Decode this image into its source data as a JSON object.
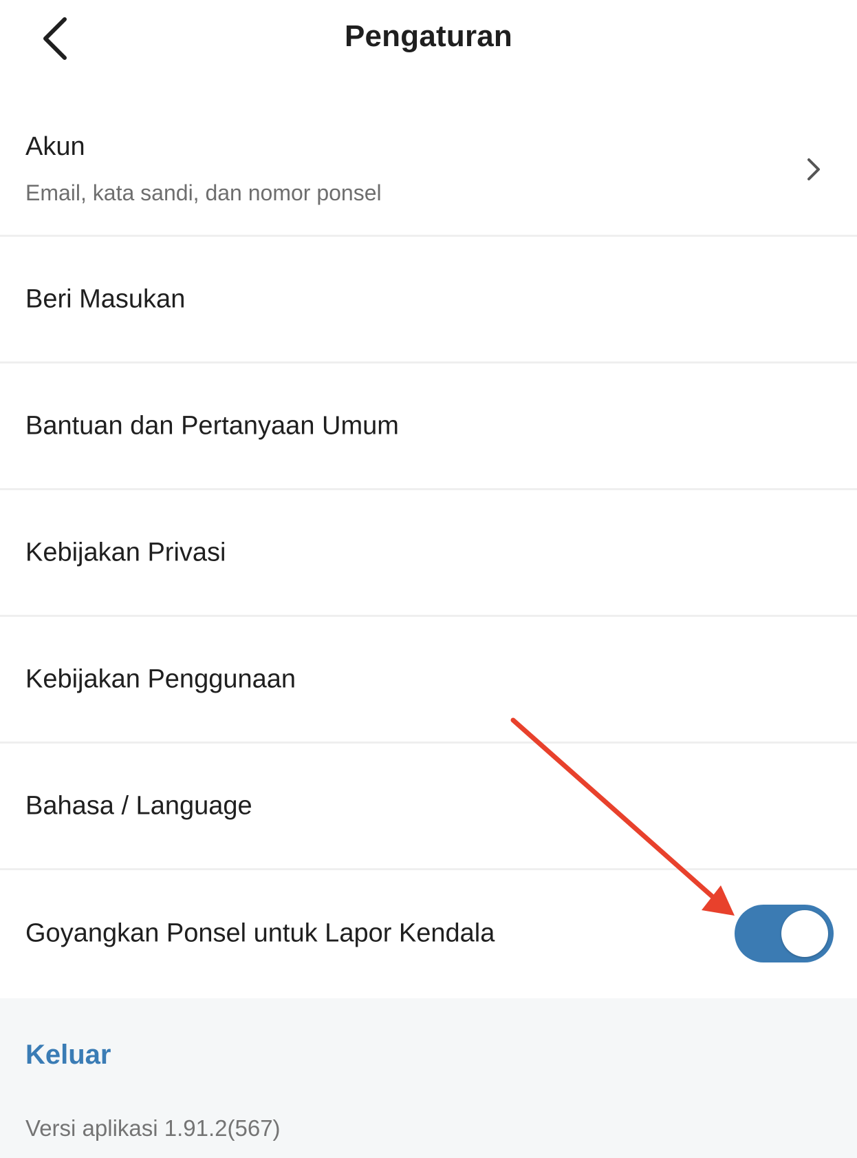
{
  "header": {
    "title": "Pengaturan",
    "back_icon": "chevron-left-icon"
  },
  "settings": {
    "account": {
      "label": "Akun",
      "subtitle": "Email, kata sandi, dan nomor ponsel",
      "icon": "chevron-right-icon"
    },
    "items": [
      {
        "label": "Beri Masukan"
      },
      {
        "label": "Bantuan dan Pertanyaan Umum"
      },
      {
        "label": "Kebijakan Privasi"
      },
      {
        "label": "Kebijakan Penggunaan"
      },
      {
        "label": "Bahasa / Language"
      }
    ],
    "shake_report": {
      "label": "Goyangkan Ponsel untuk Lapor Kendala",
      "enabled": true,
      "toggle_color": "#3b7bb3"
    }
  },
  "footer": {
    "logout_label": "Keluar",
    "logout_color": "#3a7cb5",
    "version_text": "Versi aplikasi 1.91.2(567)"
  },
  "annotation": {
    "arrow_color": "#e8412c"
  }
}
